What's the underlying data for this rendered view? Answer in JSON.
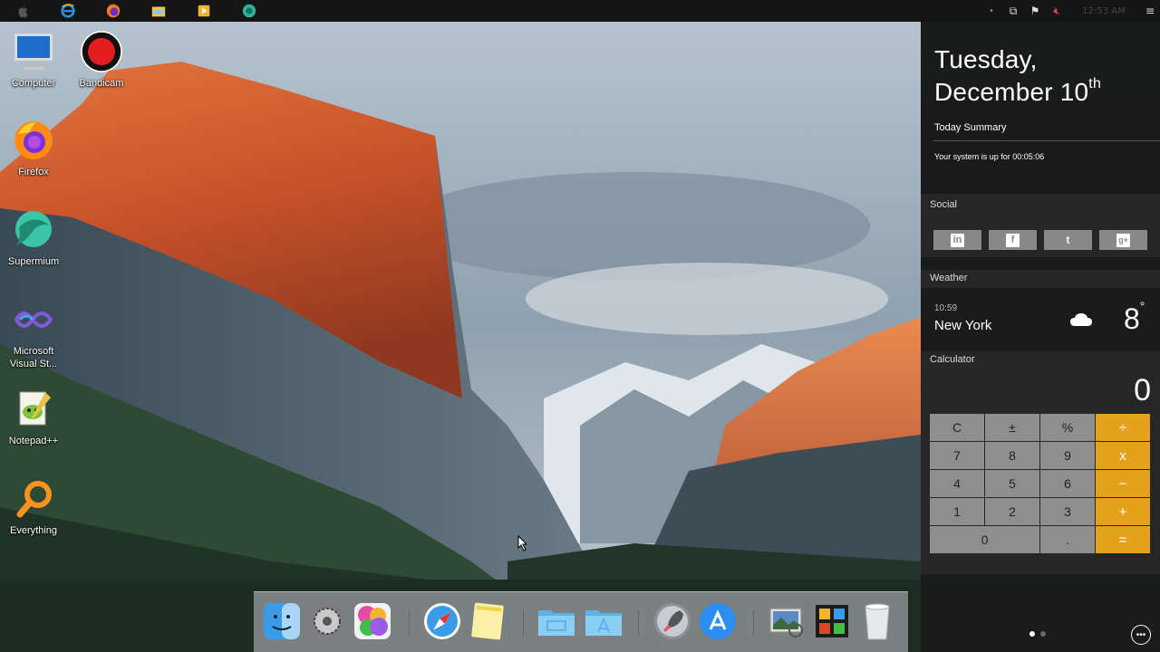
{
  "taskbar": {
    "apps": [
      {
        "name": "apple-icon"
      },
      {
        "name": "internet-explorer-icon"
      },
      {
        "name": "firefox-icon"
      },
      {
        "name": "file-explorer-icon"
      },
      {
        "name": "media-player-icon"
      },
      {
        "name": "supermium-icon"
      }
    ],
    "tray": {
      "clock": "12:53 AM"
    }
  },
  "desktop_icons": [
    {
      "label": "Computer",
      "icon": "computer-icon"
    },
    {
      "label": "Bandicam",
      "icon": "bandicam-icon"
    },
    {
      "label": "Firefox",
      "icon": "firefox-icon"
    },
    {
      "label": "Supermium",
      "icon": "supermium-icon"
    },
    {
      "label": "Microsoft Visual St...",
      "icon": "visual-studio-icon"
    },
    {
      "label": "Notepad++",
      "icon": "notepadpp-icon"
    },
    {
      "label": "Everything",
      "icon": "everything-icon"
    }
  ],
  "panel": {
    "day": "Tuesday,",
    "date": "December 10",
    "date_suffix": "th",
    "summary_title": "Today Summary",
    "uptime": "Your system is up for 00:05:06",
    "social_title": "Social",
    "social": [
      "in",
      "f",
      "t",
      "g+"
    ],
    "weather_title": "Weather",
    "weather": {
      "time": "10:59",
      "city": "New York",
      "temp": "8",
      "unit": "°",
      "icon": "cloud-icon"
    },
    "calculator_title": "Calculator",
    "calculator": {
      "display": "0",
      "keys": [
        {
          "label": "C",
          "type": "fn"
        },
        {
          "label": "±",
          "type": "fn"
        },
        {
          "label": "%",
          "type": "fn"
        },
        {
          "label": "÷",
          "type": "op"
        },
        {
          "label": "7",
          "type": "num"
        },
        {
          "label": "8",
          "type": "num"
        },
        {
          "label": "9",
          "type": "num"
        },
        {
          "label": "x",
          "type": "op"
        },
        {
          "label": "4",
          "type": "num"
        },
        {
          "label": "5",
          "type": "num"
        },
        {
          "label": "6",
          "type": "num"
        },
        {
          "label": "−",
          "type": "op"
        },
        {
          "label": "1",
          "type": "num"
        },
        {
          "label": "2",
          "type": "num"
        },
        {
          "label": "3",
          "type": "num"
        },
        {
          "label": "+",
          "type": "op"
        },
        {
          "label": "0",
          "type": "wide"
        },
        {
          "label": ".",
          "type": "num"
        },
        {
          "label": "=",
          "type": "op"
        }
      ]
    },
    "more_glyph": "•••"
  },
  "dock": {
    "items": [
      "finder-icon",
      "system-preferences-icon",
      "game-center-icon",
      "safari-icon",
      "notes-icon",
      "folder-icon",
      "applications-folder-icon",
      "launchpad-icon",
      "app-store-icon",
      "preview-icon",
      "photo-booth-icon",
      "trash-icon"
    ]
  },
  "colors": {
    "accent_orange": "#e4a11b",
    "panel_bg": "#141414",
    "calc_key": "#8e8e8e"
  }
}
